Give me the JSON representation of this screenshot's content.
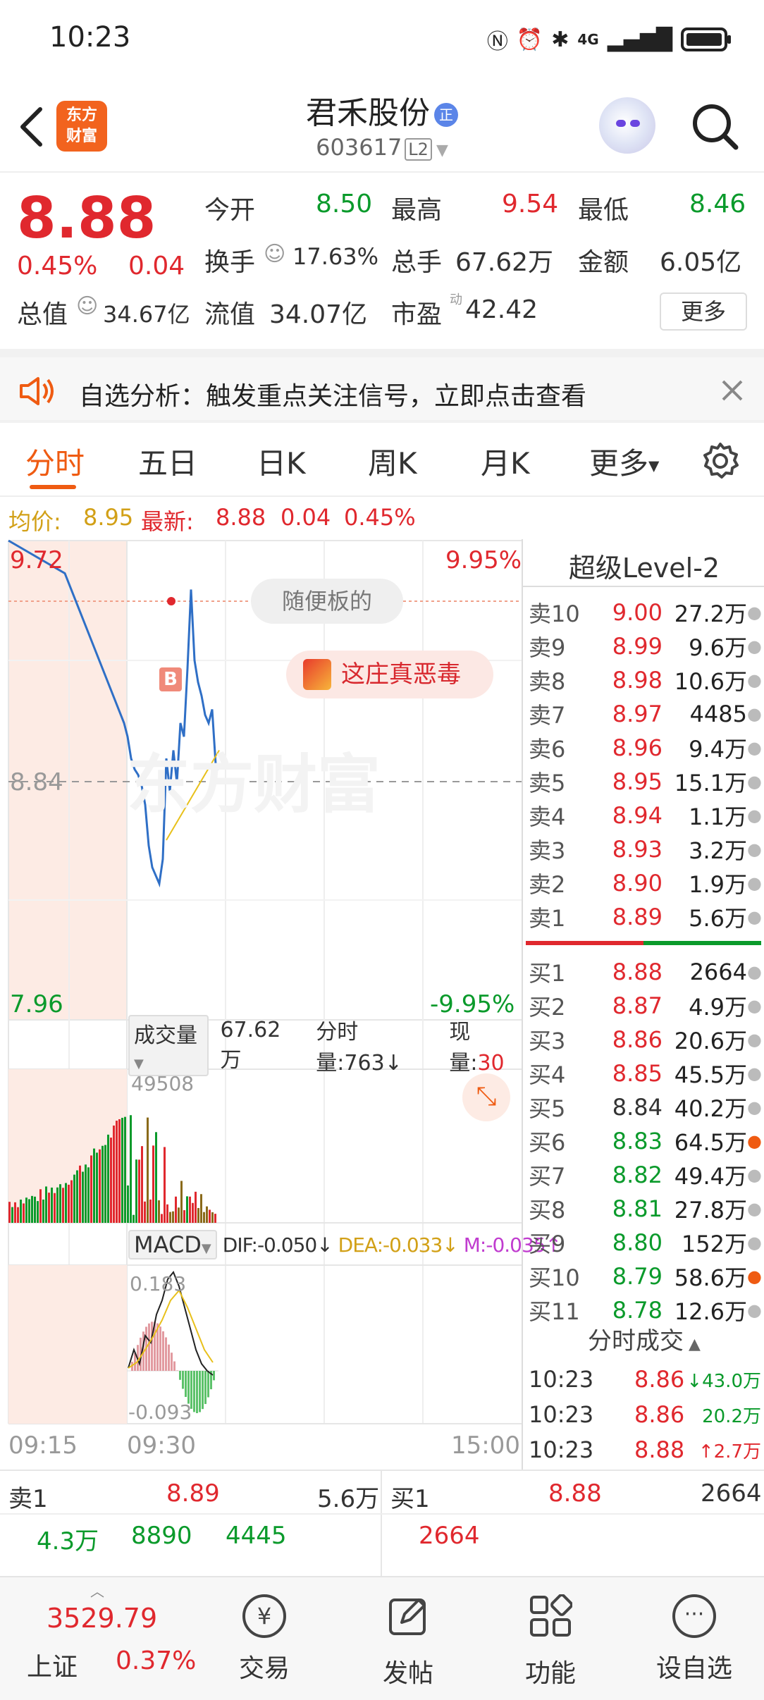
{
  "status_bar": {
    "time": "10:23",
    "network": "4G"
  },
  "header": {
    "logo_text_1": "东方",
    "logo_text_2": "财富",
    "stock_name": "君禾股份",
    "badge": "正",
    "stock_code": "603617",
    "level_tag": "L2"
  },
  "quote": {
    "price": "8.88",
    "change_pct": "0.45%",
    "change": "0.04",
    "open_label": "今开",
    "open": "8.50",
    "high_label": "最高",
    "high": "9.54",
    "low_label": "最低",
    "low": "8.46",
    "turnover_label": "换手",
    "turnover": "17.63%",
    "volume_label": "总手",
    "volume": "67.62万",
    "amount_label": "金额",
    "amount": "6.05亿",
    "mcap_label": "总值",
    "mcap": "34.67亿",
    "float_label": "流值",
    "float": "34.07亿",
    "pe_label": "市盈",
    "pe_sup": "动",
    "pe": "42.42",
    "more": "更多"
  },
  "notice": {
    "text": "自选分析：触发重点关注信号，立即点击查看"
  },
  "tabs": [
    "分时",
    "五日",
    "日K",
    "周K",
    "月K",
    "更多"
  ],
  "avg_bar": {
    "avg_label": "均价:",
    "avg": "8.95",
    "latest_label": "最新:",
    "latest": "8.88",
    "change": "0.04",
    "pct": "0.45%"
  },
  "chart": {
    "max_price": "9.72",
    "max_pct": "9.95%",
    "mid_price": "8.84",
    "min_price": "7.96",
    "min_pct": "-9.95%",
    "bubble_1": "随便板的",
    "bubble_2": "这庄真恶毒",
    "buy_mark": "B",
    "watermark": "东方财富",
    "vol_label": "成交量",
    "vol_total": "67.62万",
    "vol_tick": "分时量:763↓",
    "vol_now_label": "现量:",
    "vol_now": "30",
    "vol_max": "49508",
    "macd_label": "MACD",
    "dif": "DIF:-0.050↓",
    "dea": "DEA:-0.033↓",
    "m": "M:-0.035↑",
    "macd_max": "0.183",
    "macd_min": "-0.093",
    "time_start": "09:15",
    "time_mid": "09:30",
    "time_end": "15:00"
  },
  "chart_data": {
    "type": "line",
    "x": [
      "09:15",
      "09:25",
      "09:30",
      "09:32",
      "09:34",
      "09:36",
      "09:38",
      "09:40",
      "09:42",
      "09:44",
      "09:46",
      "09:48",
      "09:50",
      "09:52",
      "09:54",
      "09:56",
      "09:58",
      "10:00",
      "10:02",
      "10:04",
      "10:06",
      "10:08",
      "10:10",
      "10:12",
      "10:14",
      "10:16",
      "10:18",
      "10:20",
      "10:22",
      "10:23"
    ],
    "series": [
      {
        "values": [
          9.72,
          9.6,
          9.05,
          9.0,
          8.92,
          8.88,
          8.86,
          8.82,
          8.75,
          8.6,
          8.52,
          8.49,
          8.46,
          8.55,
          8.92,
          8.8,
          8.95,
          8.83,
          9.05,
          9.0,
          9.25,
          9.54,
          9.28,
          9.2,
          9.15,
          9.08,
          9.05,
          9.1,
          8.9,
          8.88
        ]
      }
    ],
    "ylim": [
      7.96,
      9.72
    ],
    "grid": true
  },
  "level2": {
    "title": "超级Level-2",
    "sells": [
      {
        "label": "卖10",
        "price": "9.00",
        "vol": "27.2万"
      },
      {
        "label": "卖9",
        "price": "8.99",
        "vol": "9.6万"
      },
      {
        "label": "卖8",
        "price": "8.98",
        "vol": "10.6万"
      },
      {
        "label": "卖7",
        "price": "8.97",
        "vol": "4485"
      },
      {
        "label": "卖6",
        "price": "8.96",
        "vol": "9.4万"
      },
      {
        "label": "卖5",
        "price": "8.95",
        "vol": "15.1万"
      },
      {
        "label": "卖4",
        "price": "8.94",
        "vol": "1.1万"
      },
      {
        "label": "卖3",
        "price": "8.93",
        "vol": "3.2万"
      },
      {
        "label": "卖2",
        "price": "8.90",
        "vol": "1.9万"
      },
      {
        "label": "卖1",
        "price": "8.89",
        "vol": "5.6万"
      }
    ],
    "buys": [
      {
        "label": "买1",
        "price": "8.88",
        "vol": "2664"
      },
      {
        "label": "买2",
        "price": "8.87",
        "vol": "4.9万"
      },
      {
        "label": "买3",
        "price": "8.86",
        "vol": "20.6万"
      },
      {
        "label": "买4",
        "price": "8.85",
        "vol": "45.5万"
      },
      {
        "label": "买5",
        "price": "8.84",
        "vol": "40.2万"
      },
      {
        "label": "买6",
        "price": "8.83",
        "vol": "64.5万"
      },
      {
        "label": "买7",
        "price": "8.82",
        "vol": "49.4万"
      },
      {
        "label": "买8",
        "price": "8.81",
        "vol": "27.8万"
      },
      {
        "label": "买9",
        "price": "8.80",
        "vol": "152万"
      },
      {
        "label": "买10",
        "price": "8.79",
        "vol": "58.6万"
      },
      {
        "label": "买11",
        "price": "8.78",
        "vol": "12.6万"
      }
    ],
    "trades_label": "分时成交",
    "trades": [
      {
        "time": "10:23",
        "price": "8.86",
        "vol": "↓43.0万"
      },
      {
        "time": "10:23",
        "price": "8.86",
        "vol": "20.2万"
      },
      {
        "time": "10:23",
        "price": "8.88",
        "vol": "↑2.7万"
      }
    ]
  },
  "bottom_quote": {
    "sell_label": "卖1",
    "sell_price": "8.89",
    "sell_vol": "5.6万",
    "buy_label": "买1",
    "buy_price": "8.88",
    "buy_vol": "2664",
    "detail_1": "4.3万",
    "detail_2": "8890",
    "detail_3": "4445",
    "detail_4": "2664"
  },
  "nav": {
    "index_value": "3529.79",
    "index_name": "上证",
    "index_pct": "0.37%",
    "trade": "交易",
    "post": "发帖",
    "func": "功能",
    "watch": "设自选"
  }
}
